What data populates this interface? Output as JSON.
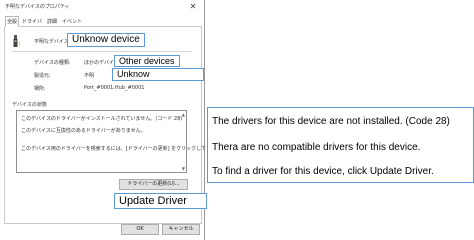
{
  "window": {
    "title": "不明なデバイスのプロパティ",
    "close_glyph": "✕"
  },
  "tabs": [
    {
      "label": "全般",
      "active": true
    },
    {
      "label": "ドライバー",
      "active": false
    },
    {
      "label": "詳細",
      "active": false
    },
    {
      "label": "イベント",
      "active": false
    }
  ],
  "device": {
    "icon": "unknown-device-icon",
    "name": "不明なデバイス"
  },
  "properties": {
    "type_label": "デバイスの種類:",
    "type_value": "ほかのデバイス",
    "manufacturer_label": "製造元:",
    "manufacturer_value": "不明",
    "location_label": "場所:",
    "location_value": "Port_#0001.Hub_#0001"
  },
  "status": {
    "group_label": "デバイスの状態",
    "line1": "このデバイスのドライバーがインストールされていません。(コード 28)",
    "line2": "このデバイスに互換性のあるドライバーがありません。",
    "line3": "このデバイス用のドライバーを検索するには、[ドライバーの更新] をクリックしてください。"
  },
  "buttons": {
    "update_driver": "ドライバーの更新(U)...",
    "ok": "OK",
    "cancel": "キャンセル"
  },
  "callouts": {
    "device_name": "Unknow device",
    "device_type": "Other devices",
    "manufacturer": "Unknow",
    "update_driver": "Update Driver"
  },
  "info": {
    "line1": "The drivers for this device are not installed. (Code 28)",
    "line2": "Thera are no compatible drivers for this device.",
    "line3": "To find a driver for this device, click Update Driver."
  },
  "colors": {
    "callout_border": "#5b9bd5",
    "button_bg": "#e1e1e1"
  }
}
